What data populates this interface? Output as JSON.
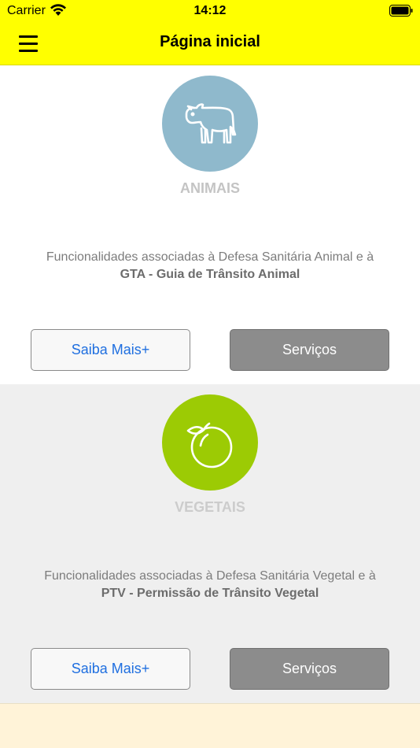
{
  "status_bar": {
    "carrier": "Carrier",
    "time": "14:12"
  },
  "nav": {
    "title": "Página inicial"
  },
  "sections": [
    {
      "title": "ANIMAIS",
      "icon": "cow-icon",
      "color": "#8fb9cc",
      "description": "Funcionalidades associadas à Defesa Sanitária Animal e à",
      "description_bold": "GTA - Guia de Trânsito Animal",
      "more_label": "Saiba Mais+",
      "services_label": "Serviços"
    },
    {
      "title": "VEGETAIS",
      "icon": "fruit-icon",
      "color": "#9ccb04",
      "description": "Funcionalidades associadas à Defesa Sanitária Vegetal e à",
      "description_bold": "PTV - Permissão de Trânsito Vegetal",
      "more_label": "Saiba Mais+",
      "services_label": "Serviços"
    }
  ],
  "colors": {
    "nav_bar": "#ffff00",
    "link": "#1f6fe0",
    "services_button": "#8c8c8c",
    "footer": "#fff3d8"
  }
}
